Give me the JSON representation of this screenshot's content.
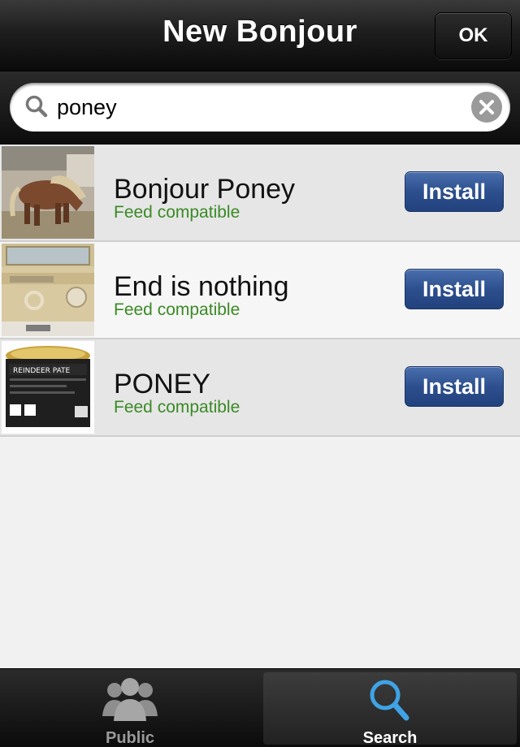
{
  "header": {
    "title": "New Bonjour",
    "ok_label": "OK"
  },
  "search": {
    "value": "poney",
    "placeholder": ""
  },
  "results": [
    {
      "title": "Bonjour Poney",
      "subtitle": "Feed compatible",
      "action": "Install",
      "thumbnail": "pony-photo"
    },
    {
      "title": "End is nothing",
      "subtitle": "Feed compatible",
      "action": "Install",
      "thumbnail": "vw-van-photo"
    },
    {
      "title": "PONEY",
      "subtitle": "Feed compatible",
      "action": "Install",
      "thumbnail": "reindeer-pate-can-photo",
      "thumbnail_text": "REINDEER PATE"
    }
  ],
  "tabs": [
    {
      "label": "Public",
      "icon": "people-icon",
      "selected": false
    },
    {
      "label": "Search",
      "icon": "magnifier-icon",
      "selected": true
    }
  ],
  "colors": {
    "subtitle": "#3a8a25",
    "install_button": "#2d4f8e",
    "header": "#1e1e1e"
  }
}
